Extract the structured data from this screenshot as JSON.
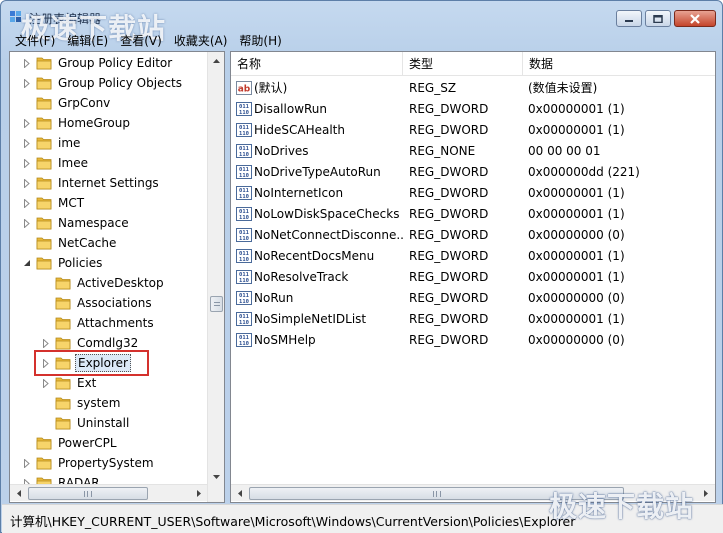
{
  "window": {
    "title": "注册表编辑器",
    "watermark": "极速下载站"
  },
  "menu": [
    {
      "label": "文件(F)"
    },
    {
      "label": "编辑(E)"
    },
    {
      "label": "查看(V)"
    },
    {
      "label": "收藏夹(A)"
    },
    {
      "label": "帮助(H)"
    }
  ],
  "tree": {
    "items": [
      {
        "label": "Group Policy Editor",
        "expandable": true
      },
      {
        "label": "Group Policy Objects",
        "expandable": true
      },
      {
        "label": "GrpConv",
        "expandable": false
      },
      {
        "label": "HomeGroup",
        "expandable": true
      },
      {
        "label": "ime",
        "expandable": true
      },
      {
        "label": "Imee",
        "expandable": true
      },
      {
        "label": "Internet Settings",
        "expandable": true
      },
      {
        "label": "MCT",
        "expandable": true
      },
      {
        "label": "Namespace",
        "expandable": true
      },
      {
        "label": "NetCache",
        "expandable": false
      },
      {
        "label": "Policies",
        "expandable": true,
        "expanded": true
      },
      {
        "label": "ActiveDesktop",
        "expandable": false
      },
      {
        "label": "Associations",
        "expandable": false
      },
      {
        "label": "Attachments",
        "expandable": false
      },
      {
        "label": "Comdlg32",
        "expandable": true
      },
      {
        "label": "Explorer",
        "expandable": true,
        "selected": true
      },
      {
        "label": "Ext",
        "expandable": true
      },
      {
        "label": "system",
        "expandable": false
      },
      {
        "label": "Uninstall",
        "expandable": false
      },
      {
        "label": "PowerCPL",
        "expandable": false
      },
      {
        "label": "PropertySystem",
        "expandable": true
      },
      {
        "label": "RADAR",
        "expandable": true
      }
    ]
  },
  "list": {
    "columns": [
      "名称",
      "类型",
      "数据"
    ],
    "rows": [
      {
        "name": "(默认)",
        "type": "REG_SZ",
        "data": "(数值未设置)",
        "icon": "string-value-icon"
      },
      {
        "name": "DisallowRun",
        "type": "REG_DWORD",
        "data": "0x00000001 (1)",
        "icon": "binary-value-icon"
      },
      {
        "name": "HideSCAHealth",
        "type": "REG_DWORD",
        "data": "0x00000001 (1)",
        "icon": "binary-value-icon"
      },
      {
        "name": "NoDrives",
        "type": "REG_NONE",
        "data": "00 00 00 01",
        "icon": "binary-value-icon"
      },
      {
        "name": "NoDriveTypeAutoRun",
        "type": "REG_DWORD",
        "data": "0x000000dd (221)",
        "icon": "binary-value-icon"
      },
      {
        "name": "NoInternetIcon",
        "type": "REG_DWORD",
        "data": "0x00000001 (1)",
        "icon": "binary-value-icon"
      },
      {
        "name": "NoLowDiskSpaceChecks",
        "type": "REG_DWORD",
        "data": "0x00000001 (1)",
        "icon": "binary-value-icon"
      },
      {
        "name": "NoNetConnectDisconne...",
        "type": "REG_DWORD",
        "data": "0x00000000 (0)",
        "icon": "binary-value-icon"
      },
      {
        "name": "NoRecentDocsMenu",
        "type": "REG_DWORD",
        "data": "0x00000001 (1)",
        "icon": "binary-value-icon"
      },
      {
        "name": "NoResolveTrack",
        "type": "REG_DWORD",
        "data": "0x00000001 (1)",
        "icon": "binary-value-icon"
      },
      {
        "name": "NoRun",
        "type": "REG_DWORD",
        "data": "0x00000000 (0)",
        "icon": "binary-value-icon"
      },
      {
        "name": "NoSimpleNetIDList",
        "type": "REG_DWORD",
        "data": "0x00000001 (1)",
        "icon": "binary-value-icon"
      },
      {
        "name": "NoSMHelp",
        "type": "REG_DWORD",
        "data": "0x00000000 (0)",
        "icon": "binary-value-icon"
      }
    ]
  },
  "status": {
    "path": "计算机\\HKEY_CURRENT_USER\\Software\\Microsoft\\Windows\\CurrentVersion\\Policies\\Explorer"
  },
  "colors": {
    "folder": "#e8b83a",
    "highlight": "#d4312d"
  }
}
